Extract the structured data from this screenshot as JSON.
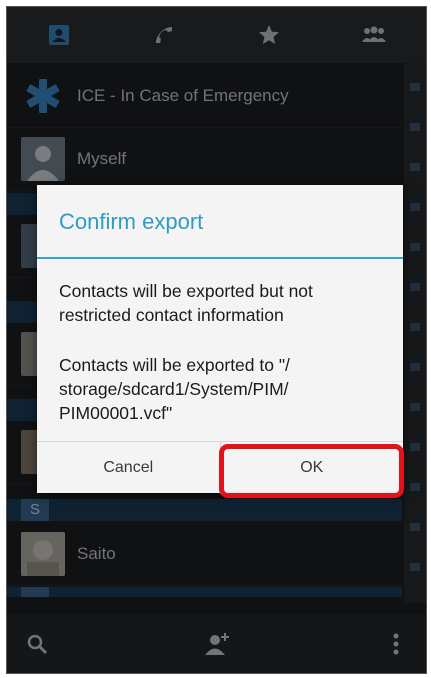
{
  "tabs": [
    {
      "icon": "contacts-icon"
    },
    {
      "icon": "phone-icon"
    },
    {
      "icon": "star-icon"
    },
    {
      "icon": "groups-icon"
    }
  ],
  "contacts": {
    "ice_label": "ICE - In Case of Emergency",
    "myself_label": "Myself",
    "saito_label": "Saito",
    "section_s": "S"
  },
  "dialog": {
    "title": "Confirm export",
    "message1": "Contacts will be exported but not restricted contact information",
    "message2": "Contacts will be exported to \"/ storage/sdcard1/System/PIM/ PIM00001.vcf\"",
    "cancel_label": "Cancel",
    "ok_label": "OK"
  },
  "bottom_bar": {
    "search_icon": "search-icon",
    "add_contact_icon": "add-contact-icon",
    "overflow_icon": "overflow-menu-icon"
  },
  "colors": {
    "accent": "#33a5d0",
    "highlight": "#e0131b"
  }
}
